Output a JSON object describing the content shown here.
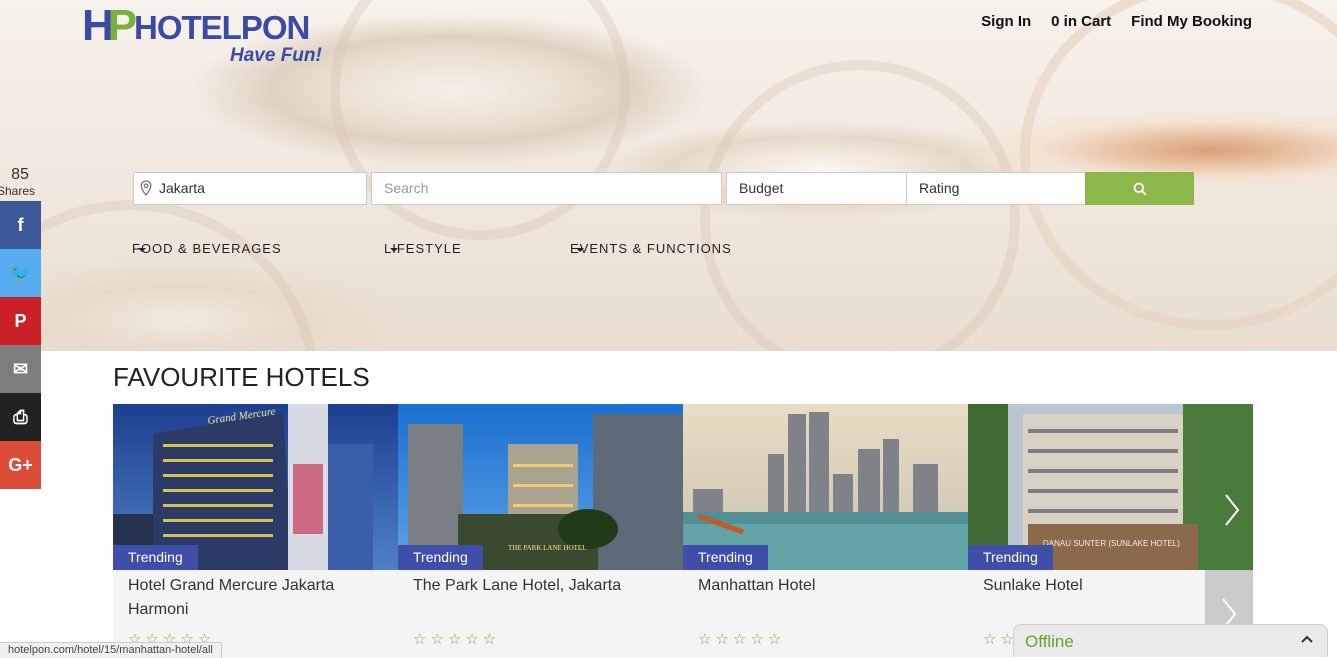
{
  "brand": {
    "mark_h": "H",
    "mark_p": "P",
    "name": "HOTELPON",
    "tagline": "Have Fun!"
  },
  "topnav": {
    "sign_in": "Sign In",
    "cart": "0 in Cart",
    "find_booking": "Find My Booking"
  },
  "share": {
    "count": "85",
    "label": "Shares",
    "buttons": [
      {
        "icon": "facebook-icon",
        "glyph": "f",
        "color": "#3b5998"
      },
      {
        "icon": "twitter-icon",
        "glyph": "🐦",
        "color": "#55acee"
      },
      {
        "icon": "pinterest-icon",
        "glyph": "P",
        "color": "#cb2027"
      },
      {
        "icon": "email-icon",
        "glyph": "✉",
        "color": "#7d7d7d"
      },
      {
        "icon": "print-icon",
        "glyph": "⎙",
        "color": "#222222"
      },
      {
        "icon": "google-plus-icon",
        "glyph": "G+",
        "color": "#dd4b39"
      }
    ]
  },
  "search": {
    "location_value": "Jakarta",
    "search_placeholder": "Search",
    "budget_value": "Budget",
    "rating_value": "Rating",
    "button_color": "#8cb84a"
  },
  "categories": [
    {
      "label": "FOOD & BEVERAGES"
    },
    {
      "label": "LIFESTYLE"
    },
    {
      "label": "EVENTS & FUNCTIONS"
    }
  ],
  "section": {
    "title": "FAVOURITE HOTELS"
  },
  "hotels": [
    {
      "badge": "Trending",
      "name": "Hotel Grand Mercure Jakarta Harmoni",
      "stars": "☆☆☆☆☆",
      "sign": "Grand Mercure"
    },
    {
      "badge": "Trending",
      "name": "The Park Lane Hotel, Jakarta",
      "stars": "☆☆☆☆☆",
      "sign": "THE PARK LANE HOTEL"
    },
    {
      "badge": "Trending",
      "name": "Manhattan Hotel",
      "stars": "☆☆☆☆☆"
    },
    {
      "badge": "Trending",
      "name": "Sunlake Hotel",
      "stars": "☆☆",
      "sign": "DANAU SUNTER (SUNLAKE HOTEL)"
    }
  ],
  "status_url": "hotelpon.com/hotel/15/manhattan-hotel/all",
  "chat": {
    "status": "Offline"
  },
  "colors": {
    "brand_blue": "#3b4ba4",
    "brand_green": "#7bb13a",
    "badge": "#3f4ea8"
  }
}
